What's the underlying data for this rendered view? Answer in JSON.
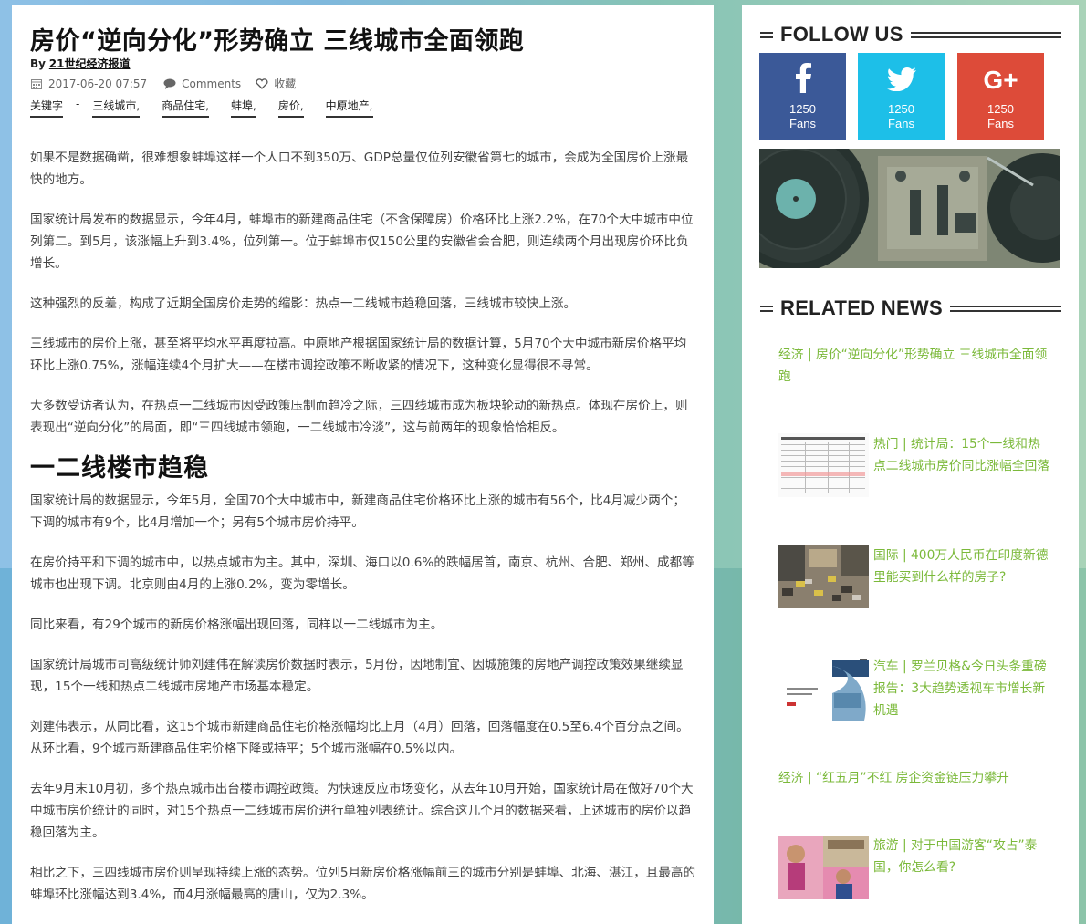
{
  "article": {
    "title": "房价“逆向分化”形势确立 三线城市全面领跑",
    "by_label": "By",
    "author": "21世纪经济报道",
    "date": "2017-06-20 07:57",
    "comments_label": "Comments",
    "favorite_label": "收藏",
    "tags": [
      "关键字",
      "-",
      "三线城市,",
      "商品住宅,",
      "蚌埠,",
      "房价,",
      "中原地产,"
    ],
    "paragraphs": [
      "如果不是数据确凿，很难想象蚌埠这样一个人口不到350万、GDP总量仅位列安徽省第七的城市，会成为全国房价上涨最快的地方。",
      "国家统计局发布的数据显示，今年4月，蚌埠市的新建商品住宅（不含保障房）价格环比上涨2.2%，在70个大中城市中位列第二。到5月，该涨幅上升到3.4%，位列第一。位于蚌埠市仅150公里的安徽省会合肥，则连续两个月出现房价环比负增长。",
      "这种强烈的反差，构成了近期全国房价走势的缩影：热点一二线城市趋稳回落，三线城市较快上涨。",
      "三线城市的房价上涨，甚至将平均水平再度拉高。中原地产根据国家统计局的数据计算，5月70个大中城市新房价格平均环比上涨0.75%，涨幅连续4个月扩大——在楼市调控政策不断收紧的情况下，这种变化显得很不寻常。",
      "大多数受访者认为，在热点一二线城市因受政策压制而趋冷之际，三四线城市成为板块轮动的新热点。体现在房价上，则表现出“逆向分化”的局面，即“三四线城市领跑，一二线城市冷淡”，这与前两年的现象恰恰相反。"
    ],
    "subheading": "一二线楼市趋稳",
    "paragraphs2": [
      "国家统计局的数据显示，今年5月，全国70个大中城市中，新建商品住宅价格环比上涨的城市有56个，比4月减少两个；下调的城市有9个，比4月增加一个；另有5个城市房价持平。",
      "在房价持平和下调的城市中，以热点城市为主。其中，深圳、海口以0.6%的跌幅居首，南京、杭州、合肥、郑州、成都等城市也出现下调。北京则由4月的上涨0.2%，变为零增长。",
      "同比来看，有29个城市的新房价格涨幅出现回落，同样以一二线城市为主。",
      "国家统计局城市司高级统计师刘建伟在解读房价数据时表示，5月份，因地制宜、因城施策的房地产调控政策效果继续显现，15个一线和热点二线城市房地产市场基本稳定。",
      "刘建伟表示，从同比看，这15个城市新建商品住宅价格涨幅均比上月（4月）回落，回落幅度在0.5至6.4个百分点之间。从环比看，9个城市新建商品住宅价格下降或持平；5个城市涨幅在0.5%以内。",
      "去年9月末10月初，多个热点城市出台楼市调控政策。为快速反应市场变化，从去年10月开始，国家统计局在做好70个大中城市房价统计的同时，对15个热点一二线城市房价进行单独列表统计。综合这几个月的数据来看，上述城市的房价以趋稳回落为主。",
      "相比之下，三四线城市房价则呈现持续上涨的态势。位列5月新房价格涨幅前三的城市分别是蚌埠、北海、湛江，且最高的蚌埠环比涨幅达到3.4%，而4月涨幅最高的唐山，仅为2.3%。"
    ]
  },
  "sidebar": {
    "follow_title": "FOLLOW US",
    "social": [
      {
        "network": "facebook",
        "glyph": "f",
        "count": "1250",
        "fans": "Fans",
        "color": "#3b5998"
      },
      {
        "network": "twitter",
        "glyph": "twitter-bird",
        "count": "1250",
        "fans": "Fans",
        "color": "#1dbfe8"
      },
      {
        "network": "google-plus",
        "glyph": "G+",
        "count": "1250",
        "fans": "Fans",
        "color": "#dd4b39"
      }
    ],
    "related_title": "RELATED NEWS",
    "news": [
      {
        "text": "经济 | 房价“逆向分化”形势确立 三线城市全面领跑",
        "thumb": null
      },
      {
        "text": "热门 | 统计局：15个一线和热点二线城市房价同比涨幅全回落",
        "thumb": "table-chart"
      },
      {
        "text": "国际 | 400万人民币在印度新德里能买到什么样的房子?",
        "thumb": "street-scene"
      },
      {
        "text": "汽车 | 罗兰贝格&今日头条重磅报告：3大趋势透视车市增长新机遇",
        "thumb": "report-cover"
      },
      {
        "text": "经济 | “红五月”不红 房企资金链压力攀升",
        "thumb": null
      },
      {
        "text": "旅游 | 对于中国游客“攻占”泰国，你怎么看?",
        "thumb": "tourists"
      }
    ]
  },
  "colors": {
    "link_green": "#7bb93a",
    "accent": "#333333"
  }
}
